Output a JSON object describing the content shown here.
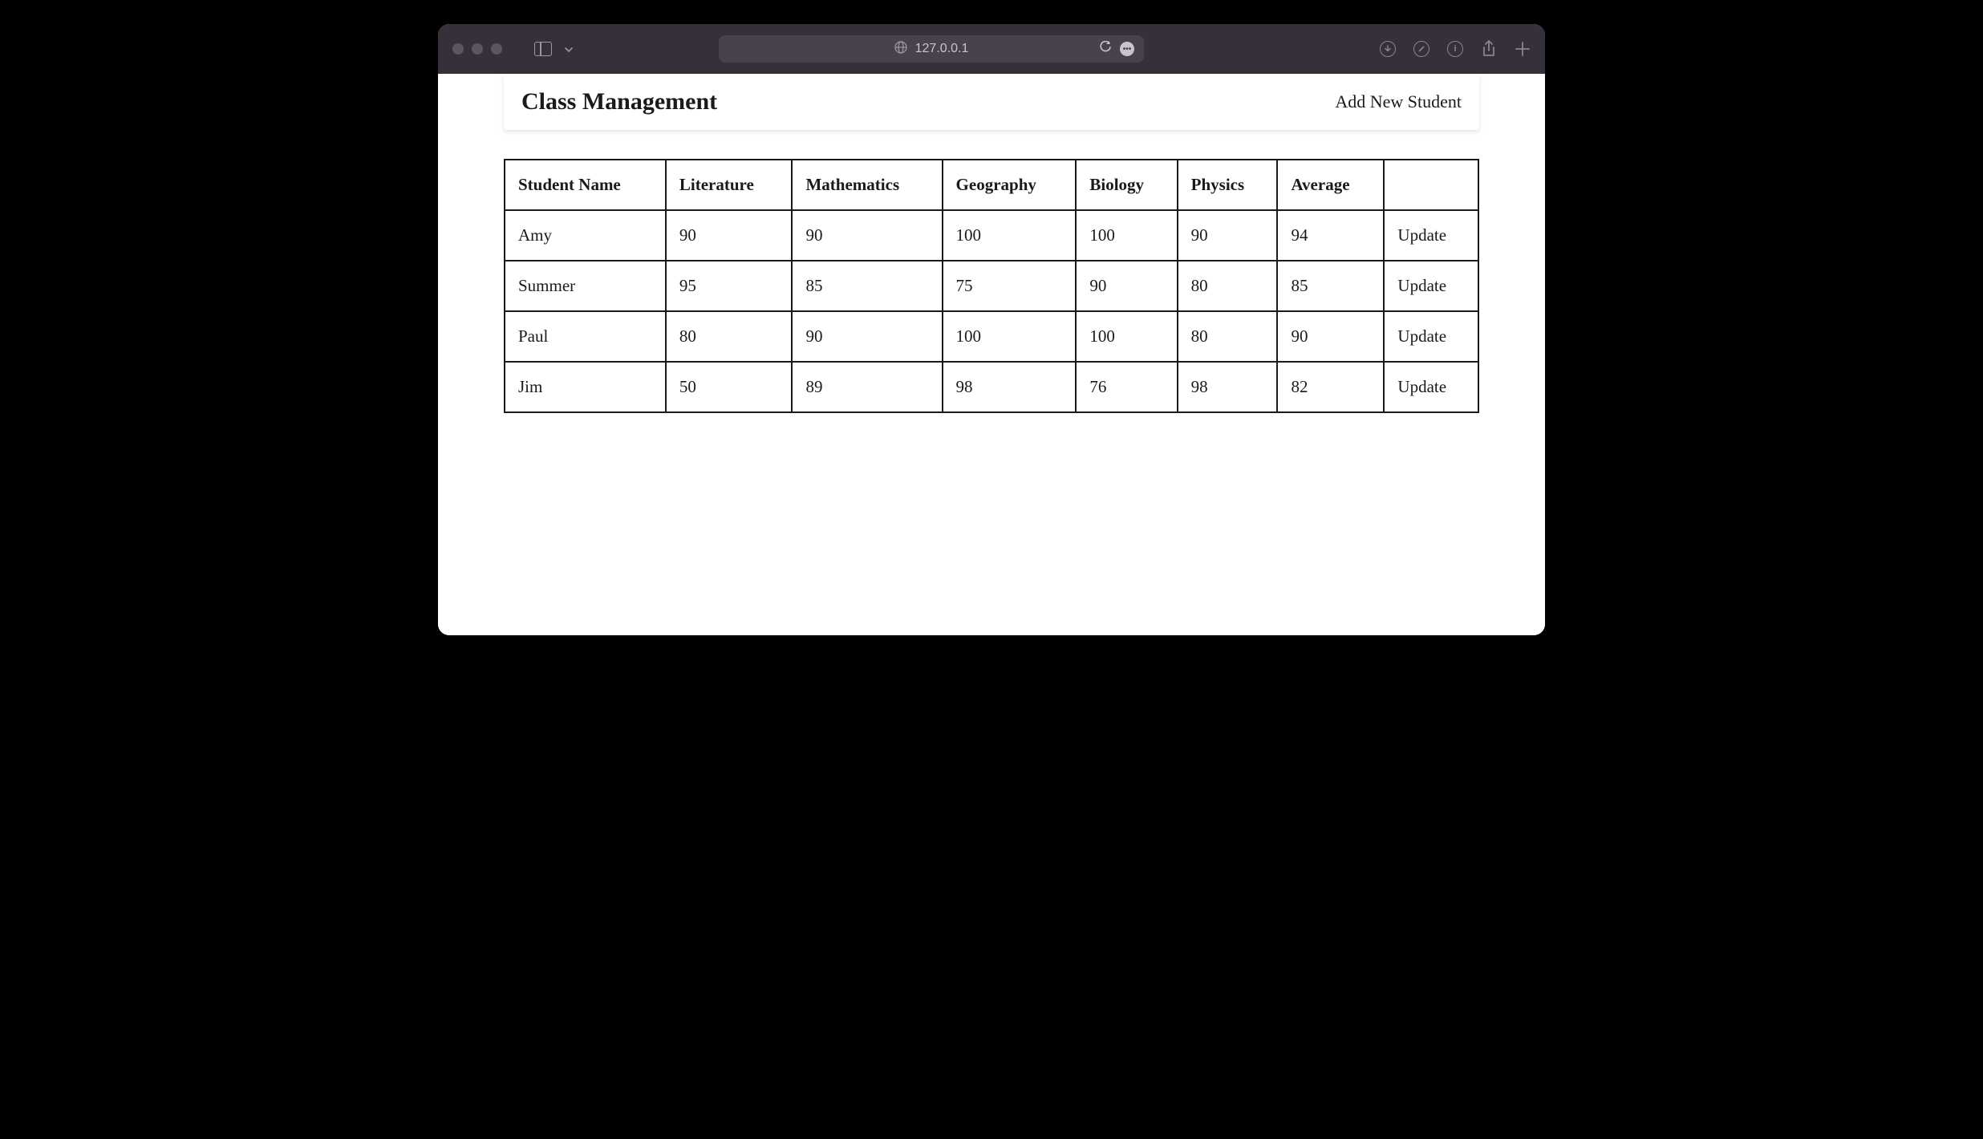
{
  "browser": {
    "url": "127.0.0.1"
  },
  "header": {
    "title": "Class Management",
    "add_button": "Add New Student"
  },
  "table": {
    "columns": [
      "Student Name",
      "Literature",
      "Mathematics",
      "Geography",
      "Biology",
      "Physics",
      "Average"
    ],
    "action_label": "Update",
    "rows": [
      {
        "name": "Amy",
        "literature": "90",
        "mathematics": "90",
        "geography": "100",
        "biology": "100",
        "physics": "90",
        "average": "94"
      },
      {
        "name": "Summer",
        "literature": "95",
        "mathematics": "85",
        "geography": "75",
        "biology": "90",
        "physics": "80",
        "average": "85"
      },
      {
        "name": "Paul",
        "literature": "80",
        "mathematics": "90",
        "geography": "100",
        "biology": "100",
        "physics": "80",
        "average": "90"
      },
      {
        "name": "Jim",
        "literature": "50",
        "mathematics": "89",
        "geography": "98",
        "biology": "76",
        "physics": "98",
        "average": "82"
      }
    ]
  }
}
